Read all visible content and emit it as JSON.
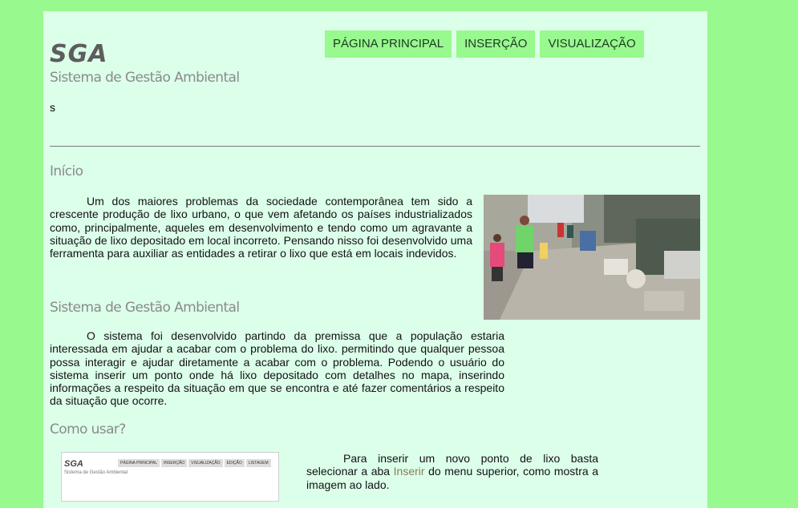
{
  "header": {
    "logo": "SGA",
    "subtitle": "Sistema de Gestão Ambiental",
    "stray_text": "s"
  },
  "nav": {
    "items": [
      "PÁGINA PRINCIPAL",
      "INSERÇÃO",
      "VISUALIZAÇÃO"
    ]
  },
  "sections": {
    "inicio": {
      "title": "Início",
      "text": "Um dos maiores problemas da sociedade contemporânea tem sido a crescente produção de lixo urbano, o que vem afetando os países industrializados como, principalmente, aqueles em desenvolvimento e tendo como um agravante a situação de lixo depositado em local incorreto. Pensando nisso foi desenvolvido uma ferramenta para auxiliar as entidades a retirar o lixo que está em locais indevidos."
    },
    "sga": {
      "title": "Sistema de Gestão Ambiental",
      "text": "O sistema foi desenvolvido partindo da premissa que a população estaria interessada em ajudar a acabar com o problema do lixo. permitindo que qualquer pessoa possa interagir e ajudar diretamente a acabar com o problema. Podendo o usuário do sistema inserir um ponto onde há lixo depositado com detalhes no mapa, inserindo informações a respeito da situação em que se encontra e até fazer comentários a respeito da situação que ocorre."
    },
    "como_usar": {
      "title": "Como usar?",
      "text_before": "Para inserir um novo ponto de lixo basta selecionar a aba ",
      "link": "Inserir",
      "text_after": " do menu superior, como mostra a imagem ao lado."
    }
  },
  "mini_screenshot": {
    "logo": "SGA",
    "subtitle": "Sistema de Gestão Ambiental",
    "nav": [
      "PÁGINA PRINCIPAL",
      "INSERÇÃO",
      "VISUALIZAÇÃO",
      "EDIÇÃO",
      "LISTAGEM"
    ]
  },
  "colors": {
    "background": "#98f98e",
    "page": "#dcffea",
    "nav_button": "#98f98e"
  }
}
